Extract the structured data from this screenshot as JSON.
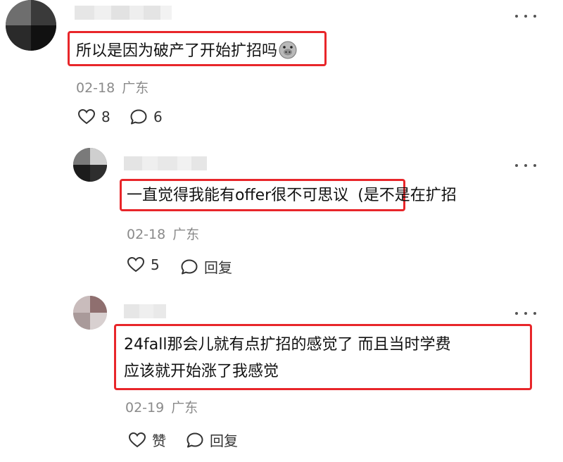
{
  "comments": [
    {
      "text": "所以是因为破产了开始扩招吗",
      "emoji_icon": "pig-face-emoji-icon",
      "date": "02-18",
      "location": "广东",
      "like_count": "8",
      "reply_count": "6"
    },
    {
      "text": "一直觉得我能有offer很不可思议",
      "text_after": " (是不是在扩招",
      "date": "02-18",
      "location": "广东",
      "like_count": "5",
      "reply_label": "回复"
    },
    {
      "lines": [
        "24fall那会儿就有点扩招的感觉了 而且当时学费",
        "应该就开始涨了我感觉"
      ],
      "date": "02-19",
      "location": "广东",
      "like_label": "赞",
      "reply_label": "回复"
    }
  ],
  "icons": {
    "like": "heart-icon",
    "reply": "speech-bubble-icon",
    "more": "more-dots-icon"
  },
  "colors": {
    "highlight": "#e8262a",
    "meta": "#8a8a8a"
  }
}
